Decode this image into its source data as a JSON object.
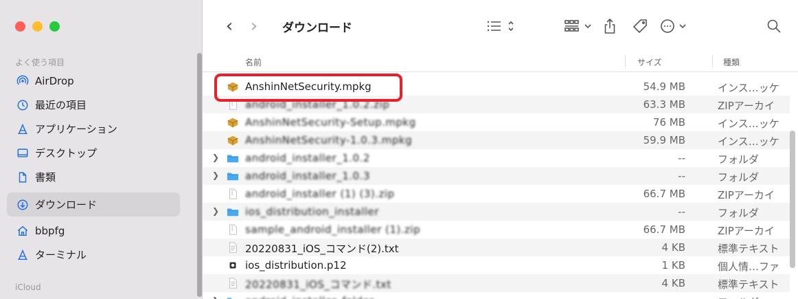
{
  "window": {
    "traffic": {
      "close": "#ff5f57",
      "minimize": "#febc2e",
      "maximize": "#28c840"
    }
  },
  "sidebar": {
    "favorites_heading": "よく使う項目",
    "items": [
      {
        "label": "AirDrop",
        "icon": "airdrop-icon"
      },
      {
        "label": "最近の項目",
        "icon": "clock-icon"
      },
      {
        "label": "アプリケーション",
        "icon": "applications-icon"
      },
      {
        "label": "デスクトップ",
        "icon": "desktop-icon"
      },
      {
        "label": "書類",
        "icon": "document-icon"
      },
      {
        "label": "ダウンロード",
        "icon": "download-icon",
        "selected": true
      },
      {
        "label": "bbpfg",
        "icon": "home-icon"
      },
      {
        "label": "ターミナル",
        "icon": "applications-icon"
      }
    ],
    "icloud_heading": "iCloud"
  },
  "toolbar": {
    "back": "‹",
    "forward": "›",
    "title": "ダウンロード"
  },
  "columns": {
    "name": "名前",
    "size": "サイズ",
    "kind": "種類"
  },
  "files": [
    {
      "name": "AnshinNetSecurity.mpkg",
      "size": "54.9 MB",
      "kind": "インス…ッケ",
      "icon": "package-icon",
      "blurred": false
    },
    {
      "name": "android_installer_1.0.2.zip",
      "size": "63.3 MB",
      "kind": "ZIPアーカイ",
      "icon": "zip-icon",
      "blurred": true
    },
    {
      "name": "AnshinNetSecurity-Setup.mpkg",
      "size": "76 MB",
      "kind": "インス…ッケ",
      "icon": "package-icon",
      "blurred": true
    },
    {
      "name": "AnshinNetSecurity-1.0.3.mpkg",
      "size": "59.9 MB",
      "kind": "インス…ッケ",
      "icon": "package-icon",
      "blurred": true
    },
    {
      "name": "android_installer_1.0.2",
      "size": "--",
      "kind": "フォルダ",
      "icon": "folder-icon",
      "blurred": true,
      "folder": true
    },
    {
      "name": "android_installer_1.0.3",
      "size": "--",
      "kind": "フォルダ",
      "icon": "folder-icon",
      "blurred": true,
      "folder": true
    },
    {
      "name": "android_installer (1) (3).zip",
      "size": "66.7 MB",
      "kind": "ZIPアーカイ",
      "icon": "zip-icon",
      "blurred": true
    },
    {
      "name": "ios_distribution_installer",
      "size": "--",
      "kind": "フォルダ",
      "icon": "folder-icon",
      "blurred": true,
      "folder": true
    },
    {
      "name": "sample_android_installer (1).zip",
      "size": "66.7 MB",
      "kind": "ZIPアーカイ",
      "icon": "zip-icon",
      "blurred": true
    },
    {
      "name": "20220831_iOS_コマンド(2).txt",
      "size": "4 KB",
      "kind": "標準テキスト",
      "icon": "text-icon",
      "blurred": false
    },
    {
      "name": "ios_distribution.p12",
      "size": "1 KB",
      "kind": "個人情…ファ",
      "icon": "certificate-icon",
      "blurred": false
    },
    {
      "name": "20220831_iOS_コマンド.txt",
      "size": "4 KB",
      "kind": "標準テキスト",
      "icon": "text-icon",
      "blurred": true
    },
    {
      "name": "android_installer_folder",
      "size": "--",
      "kind": "フォルダ",
      "icon": "folder-icon",
      "blurred": true,
      "folder": true
    }
  ]
}
